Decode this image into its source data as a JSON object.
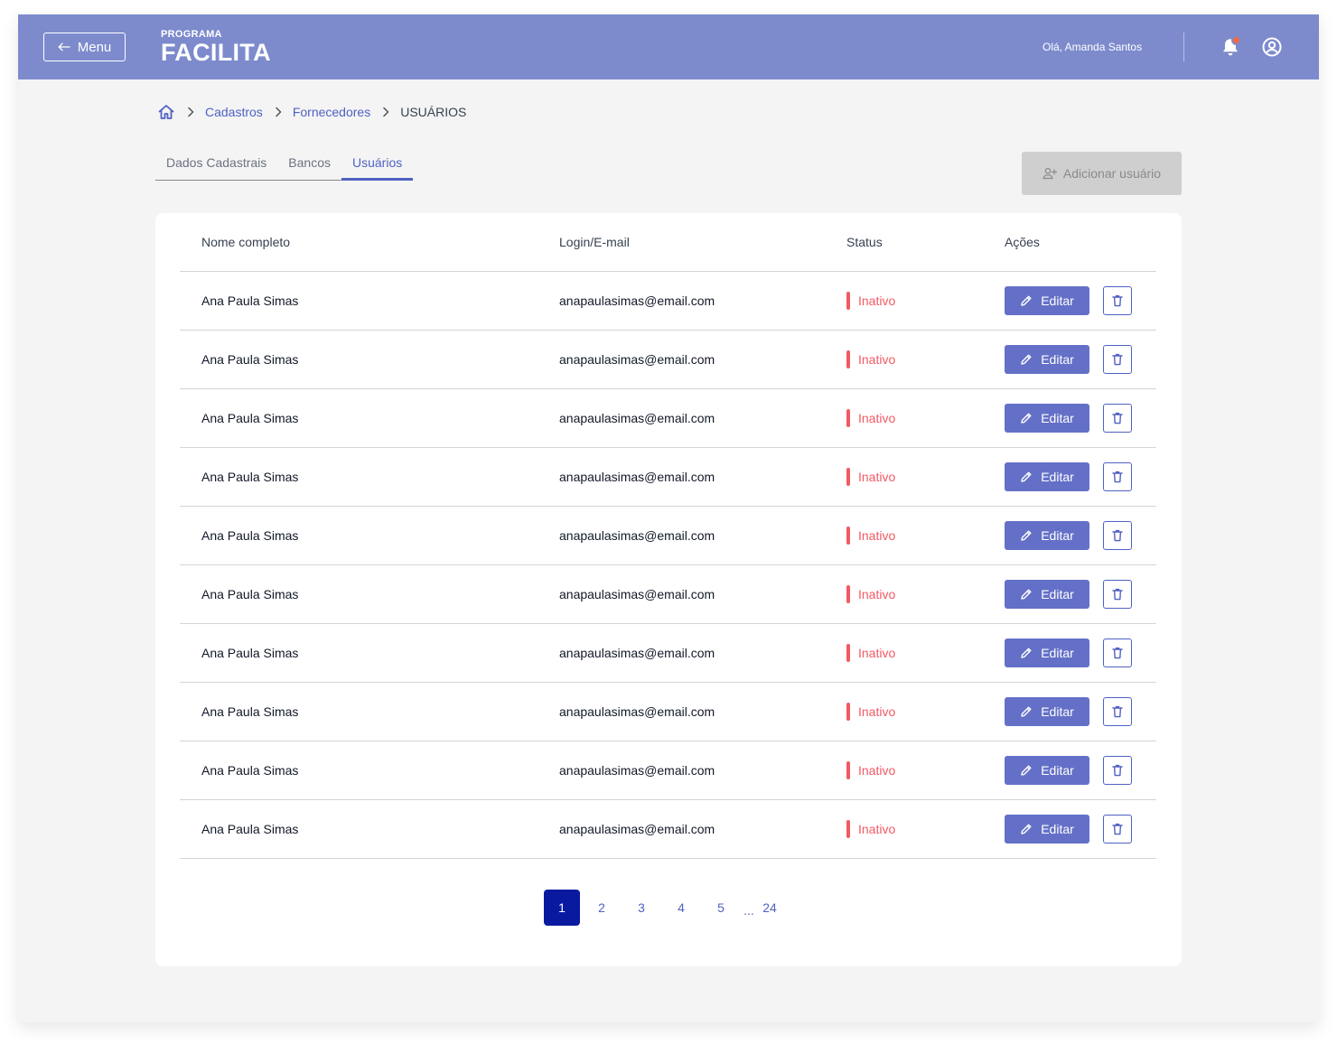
{
  "header": {
    "menu_label": "Menu",
    "logo_small": "PROGRAMA",
    "logo_big": "FACILITA",
    "greeting": "Olá, Amanda Santos",
    "notification_dot_color": "#ef6b45"
  },
  "breadcrumb": {
    "items": [
      "Cadastros",
      "Fornecedores"
    ],
    "current": "USUÁRIOS"
  },
  "tabs": [
    {
      "label": "Dados Cadastrais",
      "active": false
    },
    {
      "label": "Bancos",
      "active": false
    },
    {
      "label": "Usuários",
      "active": true
    }
  ],
  "add_user_label": "Adicionar usuário",
  "table": {
    "columns": [
      "Nome completo",
      "Login/E-mail",
      "Status",
      "Ações"
    ],
    "edit_label": "Editar",
    "rows": [
      {
        "name": "Ana Paula Simas",
        "email": "anapaulasimas@email.com",
        "status": "Inativo"
      },
      {
        "name": "Ana Paula Simas",
        "email": "anapaulasimas@email.com",
        "status": "Inativo"
      },
      {
        "name": "Ana Paula Simas",
        "email": "anapaulasimas@email.com",
        "status": "Inativo"
      },
      {
        "name": "Ana Paula Simas",
        "email": "anapaulasimas@email.com",
        "status": "Inativo"
      },
      {
        "name": "Ana Paula Simas",
        "email": "anapaulasimas@email.com",
        "status": "Inativo"
      },
      {
        "name": "Ana Paula Simas",
        "email": "anapaulasimas@email.com",
        "status": "Inativo"
      },
      {
        "name": "Ana Paula Simas",
        "email": "anapaulasimas@email.com",
        "status": "Inativo"
      },
      {
        "name": "Ana Paula Simas",
        "email": "anapaulasimas@email.com",
        "status": "Inativo"
      },
      {
        "name": "Ana Paula Simas",
        "email": "anapaulasimas@email.com",
        "status": "Inativo"
      },
      {
        "name": "Ana Paula Simas",
        "email": "anapaulasimas@email.com",
        "status": "Inativo"
      }
    ]
  },
  "pagination": {
    "pages": [
      "1",
      "2",
      "3",
      "4",
      "5"
    ],
    "current": "1",
    "ellipsis": "...",
    "last": "24"
  },
  "colors": {
    "header_bg": "#7d8bcd",
    "accent": "#5061c2",
    "edit_button": "#6470c7",
    "status_inactive": "#f25a63",
    "active_page": "#0a1aa0"
  }
}
